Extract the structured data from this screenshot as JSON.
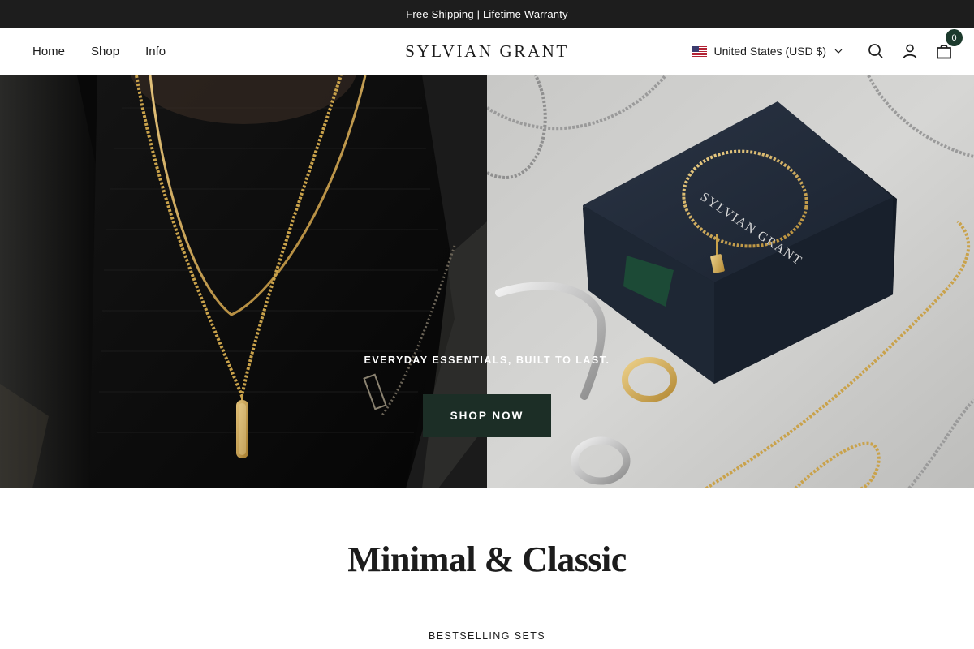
{
  "announcement": {
    "text": "Free Shipping | Lifetime Warranty"
  },
  "header": {
    "nav": [
      {
        "label": "Home"
      },
      {
        "label": "Shop"
      },
      {
        "label": "Info"
      }
    ],
    "logo": "SYLVIAN GRANT",
    "country_selector": {
      "flag": "us-flag-icon",
      "label": "United States (USD $)"
    },
    "icons": [
      "search-icon",
      "account-icon",
      "cart-icon"
    ],
    "cart_count": "0"
  },
  "hero": {
    "tagline": "EVERYDAY ESSENTIALS, BUILT TO LAST.",
    "cta_label": "SHOP NOW",
    "box_lid_text": "SYLVIAN GRANT"
  },
  "section": {
    "title": "Minimal & Classic",
    "subtitle": "BESTSELLING SETS"
  },
  "colors": {
    "announcement_bg": "#1d1d1d",
    "accent": "#1c3a2d",
    "button_bg": "#1c2e26",
    "gold": "#c9a24b"
  }
}
